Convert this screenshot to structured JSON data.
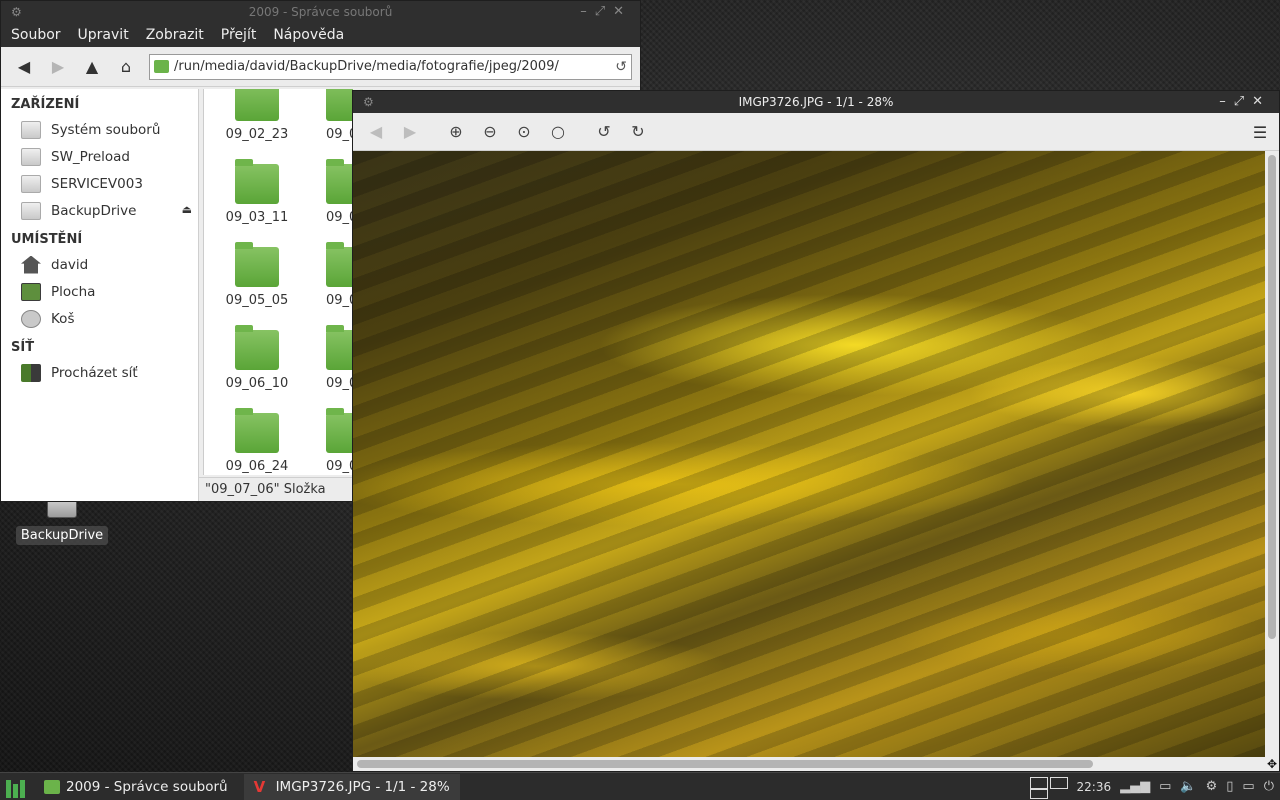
{
  "desktop": {
    "icons": [
      {
        "label": "BackupDrive",
        "icon": "drive-icon"
      }
    ]
  },
  "file_manager": {
    "title": "2009 - Správce souborů",
    "menu": [
      "Soubor",
      "Upravit",
      "Zobrazit",
      "Přejít",
      "Nápověda"
    ],
    "path": "/run/media/david/BackupDrive/media/fotografie/jpeg/2009/",
    "sidebar": {
      "devices_heading": "ZAŘÍZENÍ",
      "devices": [
        "Systém souborů",
        "SW_Preload",
        "SERVICEV003",
        "BackupDrive"
      ],
      "places_heading": "UMÍSTĚNÍ",
      "places": [
        "david",
        "Plocha",
        "Koš"
      ],
      "network_heading": "SÍŤ",
      "network": [
        "Procházet síť"
      ]
    },
    "folders": [
      "09_02_23",
      "09_03_11",
      "09_05_05",
      "09_06_10",
      "09_06_24"
    ],
    "folders_col2": [
      "09_0",
      "09_0",
      "09_0",
      "09_0",
      "09_0"
    ],
    "status": "\"09_07_06\" Složka"
  },
  "image_viewer": {
    "title": "IMGP3726.JPG - 1/1 - 28%"
  },
  "taskbar": {
    "tasks": [
      {
        "label": "2009 - Správce souborů"
      },
      {
        "label": "IMGP3726.JPG - 1/1 - 28%"
      }
    ],
    "clock": "22:36"
  }
}
